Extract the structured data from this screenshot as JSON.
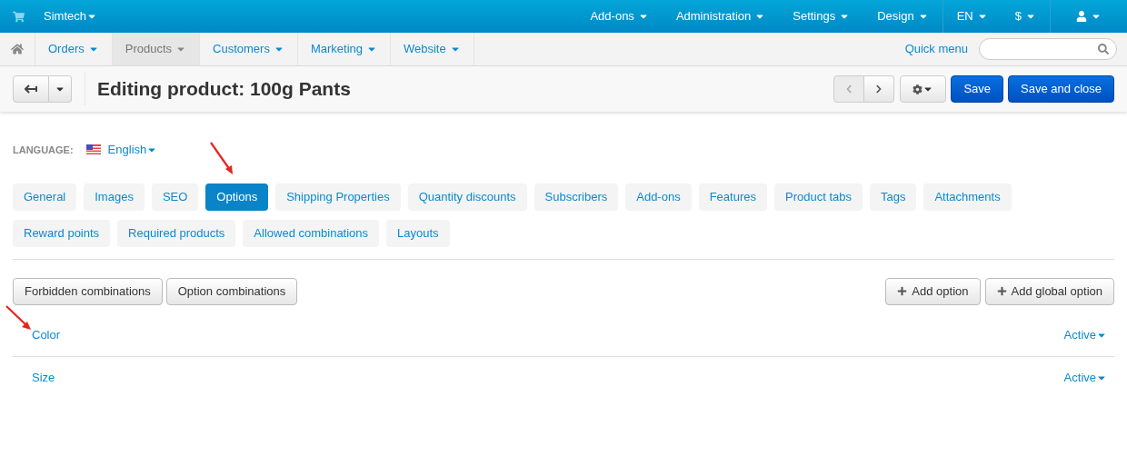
{
  "top_bar": {
    "store": "Simtech",
    "menus": [
      "Add-ons",
      "Administration",
      "Settings",
      "Design"
    ],
    "language": "EN",
    "currency": "$"
  },
  "nav": {
    "items": [
      {
        "label": "Orders",
        "selected": false
      },
      {
        "label": "Products",
        "selected": true
      },
      {
        "label": "Customers",
        "selected": false
      },
      {
        "label": "Marketing",
        "selected": false
      },
      {
        "label": "Website",
        "selected": false
      }
    ],
    "quick_menu": "Quick menu"
  },
  "header": {
    "title": "Editing product: 100g Pants",
    "buttons": [
      "Save",
      "Save and close"
    ]
  },
  "language": {
    "label": "LANGUAGE:",
    "value": "English"
  },
  "tabs": [
    {
      "label": "General",
      "selected": false
    },
    {
      "label": "Images",
      "selected": false
    },
    {
      "label": "SEO",
      "selected": false
    },
    {
      "label": "Options",
      "selected": true
    },
    {
      "label": "Shipping Properties",
      "selected": false
    },
    {
      "label": "Quantity discounts",
      "selected": false
    },
    {
      "label": "Subscribers",
      "selected": false
    },
    {
      "label": "Add-ons",
      "selected": false
    },
    {
      "label": "Features",
      "selected": false
    },
    {
      "label": "Product tabs",
      "selected": false
    },
    {
      "label": "Tags",
      "selected": false
    },
    {
      "label": "Attachments",
      "selected": false
    },
    {
      "label": "Reward points",
      "selected": false
    },
    {
      "label": "Required products",
      "selected": false
    },
    {
      "label": "Allowed combinations",
      "selected": false
    },
    {
      "label": "Layouts",
      "selected": false
    }
  ],
  "actions": {
    "left": [
      "Forbidden combinations",
      "Option combinations"
    ],
    "right": [
      "Add option",
      "Add global option"
    ]
  },
  "options": [
    {
      "name": "Color",
      "status": "Active"
    },
    {
      "name": "Size",
      "status": "Active"
    }
  ]
}
